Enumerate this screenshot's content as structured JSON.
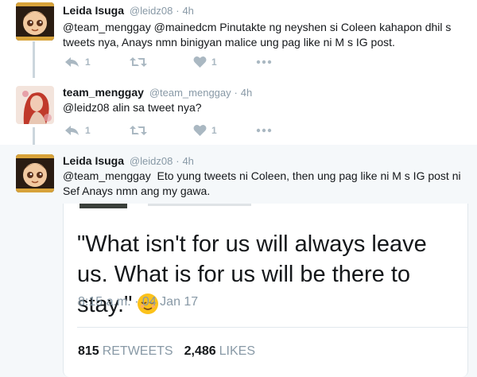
{
  "tweets": [
    {
      "name": "Leida Isuga",
      "handle": "@leidz08",
      "time": "4h",
      "text": "@team_menggay @mainedcm Pinutakte ng neyshen si Coleen kahapon dhil s tweets nya, Anays nmn binigyan malice ung pag like ni M s IG post.",
      "reply_count": "1",
      "like_count": "1"
    },
    {
      "name": "team_menggay",
      "handle": "@team_menggay",
      "time": "4h",
      "text": "@leidz08 alin sa tweet nya?",
      "reply_count": "1",
      "like_count": "1"
    },
    {
      "name": "Leida Isuga",
      "handle": "@leidz08",
      "time": "4h",
      "text": "@team_menggay  Eto yung tweets ni Coleen, then ung pag like ni M s IG post ni Sef Anays nmn ang my gawa."
    }
  ],
  "embedded": {
    "quote": "\"What isn't for us will always leave us. What is for us will be there to stay.\"",
    "emoji": "relieved-face",
    "timestamp": "8:15 a.m. · 04 Jan 17",
    "retweets": "815",
    "retweets_label": "RETWEETS",
    "likes": "2,486",
    "likes_label": "LIKES"
  },
  "dot": "·",
  "colors": {
    "meta": "#8899a6",
    "icon": "#aab8c2",
    "thread_line": "#ccd6dd",
    "highlight_bg": "#f5f8fa",
    "emoji": "#fcc21b"
  }
}
